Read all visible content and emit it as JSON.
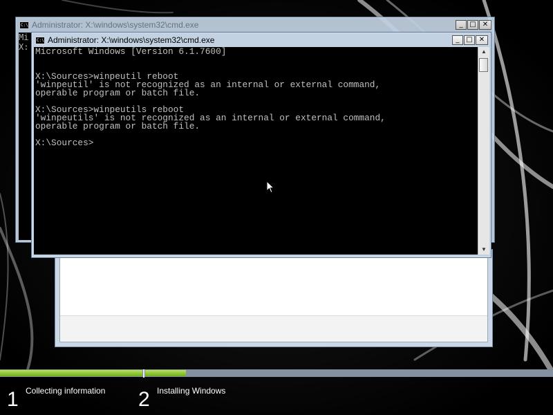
{
  "back_window": {
    "title": "Administrator: X:\\windows\\system32\\cmd.exe",
    "console_lines": [
      "Mi",
      "",
      "X:"
    ]
  },
  "front_window": {
    "title": "Administrator: X:\\windows\\system32\\cmd.exe",
    "buttons": {
      "minimize": "_",
      "maximize": "□",
      "close": "✕"
    },
    "console_lines": [
      "Microsoft Windows [Version 6.1.7600]",
      "",
      "",
      "X:\\Sources>winpeutil reboot",
      "'winpeutil' is not recognized as an internal or external command,",
      "operable program or batch file.",
      "",
      "X:\\Sources>winpeutils reboot",
      "'winpeutils' is not recognized as an internal or external command,",
      "operable program or batch file.",
      "",
      "X:\\Sources>"
    ]
  },
  "setup_progress": {
    "steps": [
      {
        "number": "1",
        "label": "Collecting information"
      },
      {
        "number": "2",
        "label": "Installing Windows"
      }
    ],
    "step1_progress": 1.0,
    "step2_progress": 0.1
  },
  "colors": {
    "console_bg": "#000000",
    "console_text": "#c0c0c0",
    "progress_fill": "#8bc53f",
    "window_frame": "#c2d2e3"
  },
  "icons": {
    "app": "cmd-icon",
    "cursor": "mouse-pointer-icon"
  }
}
